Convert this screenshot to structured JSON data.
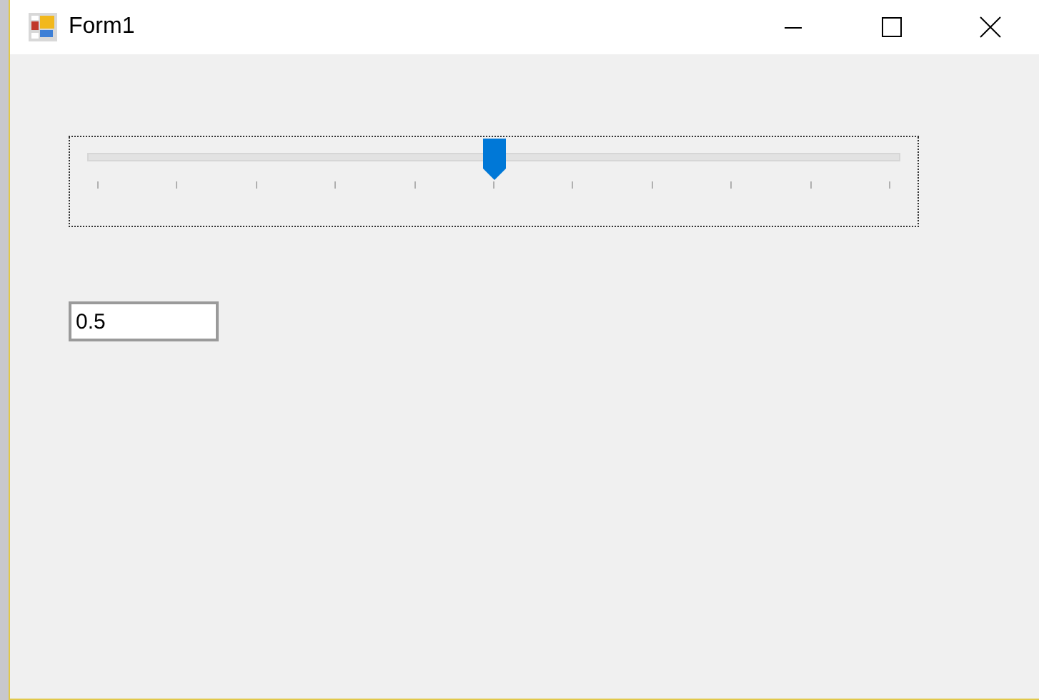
{
  "window": {
    "title": "Form1"
  },
  "slider": {
    "level": 0.5
  },
  "value_field": {
    "value": "0.5"
  }
}
